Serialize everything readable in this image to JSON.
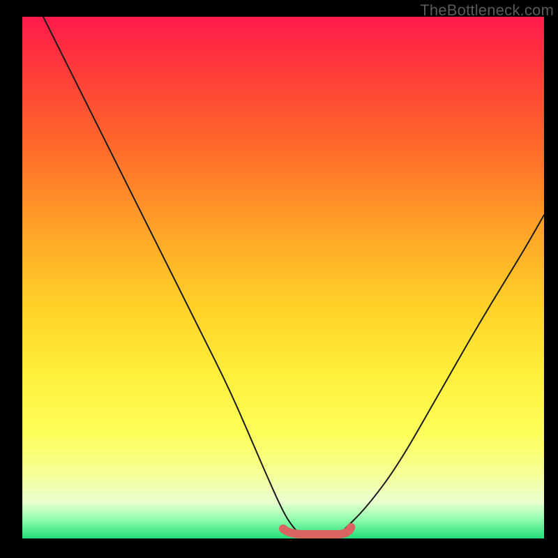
{
  "watermark": "TheBottleneck.com",
  "chart_data": {
    "type": "line",
    "title": "",
    "xlabel": "",
    "ylabel": "",
    "xlim": [
      0,
      100
    ],
    "ylim": [
      0,
      100
    ],
    "background_gradient": {
      "top": "#ff1a4d",
      "mid": "#ffd028",
      "bottom": "#22dd7a"
    },
    "series": [
      {
        "name": "bottleneck-curve",
        "x": [
          4,
          10,
          16,
          22,
          28,
          34,
          40,
          46,
          50,
          52,
          54,
          56,
          58,
          60,
          62,
          66,
          72,
          80,
          88,
          96,
          100
        ],
        "y": [
          100,
          88,
          76,
          64,
          52,
          40,
          28,
          14,
          5,
          2,
          0,
          0,
          0,
          0,
          2,
          6,
          14,
          28,
          42,
          55,
          62
        ]
      }
    ],
    "highlight": {
      "name": "optimal-range",
      "x_start": 50,
      "x_end": 63,
      "y": 0,
      "color": "#d9635e"
    }
  }
}
